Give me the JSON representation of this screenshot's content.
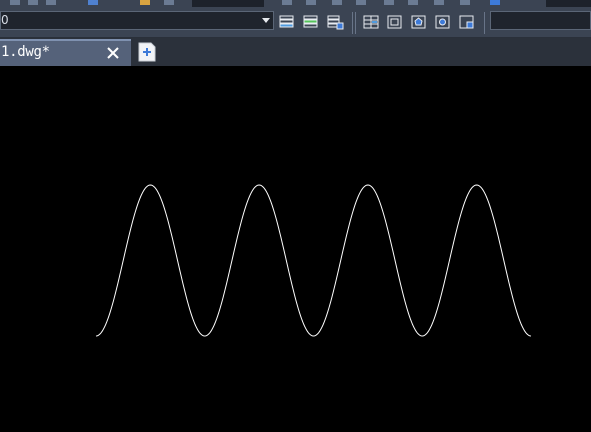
{
  "toolbar": {
    "layer_combo_value": "0"
  },
  "document_tab": {
    "title": "1.dwg*"
  },
  "colors": {
    "toolbar_bg": "#3b4453",
    "tab_active_bg": "#55627a",
    "tabbar_bg": "#2b313b",
    "canvas_bg": "#000000",
    "curve_color": "#ffffff"
  },
  "drawing": {
    "entity": "sine-wave-polyline",
    "peaks": 4,
    "troughs": 3
  }
}
